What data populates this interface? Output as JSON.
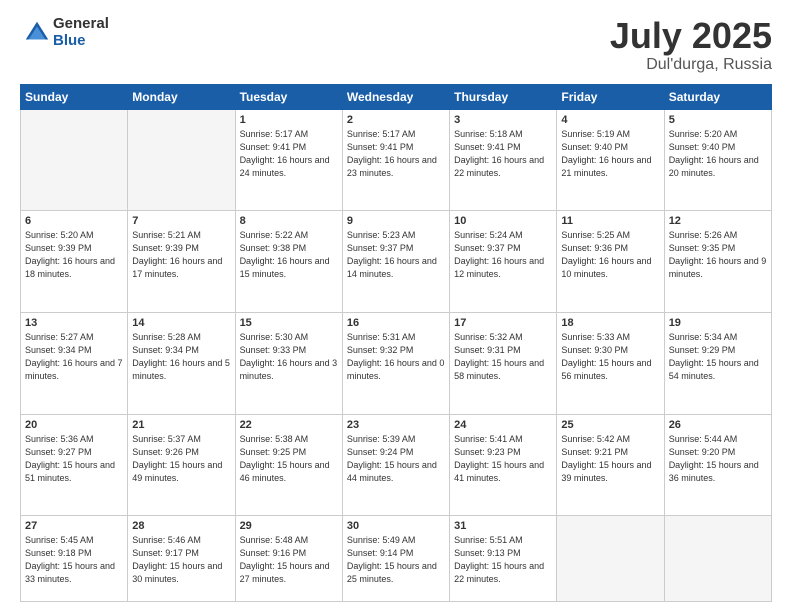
{
  "header": {
    "logo_general": "General",
    "logo_blue": "Blue",
    "title": "July 2025",
    "location": "Dul'durga, Russia"
  },
  "days_of_week": [
    "Sunday",
    "Monday",
    "Tuesday",
    "Wednesday",
    "Thursday",
    "Friday",
    "Saturday"
  ],
  "weeks": [
    [
      {
        "day": "",
        "info": ""
      },
      {
        "day": "",
        "info": ""
      },
      {
        "day": "1",
        "info": "Sunrise: 5:17 AM\nSunset: 9:41 PM\nDaylight: 16 hours\nand 24 minutes."
      },
      {
        "day": "2",
        "info": "Sunrise: 5:17 AM\nSunset: 9:41 PM\nDaylight: 16 hours\nand 23 minutes."
      },
      {
        "day": "3",
        "info": "Sunrise: 5:18 AM\nSunset: 9:41 PM\nDaylight: 16 hours\nand 22 minutes."
      },
      {
        "day": "4",
        "info": "Sunrise: 5:19 AM\nSunset: 9:40 PM\nDaylight: 16 hours\nand 21 minutes."
      },
      {
        "day": "5",
        "info": "Sunrise: 5:20 AM\nSunset: 9:40 PM\nDaylight: 16 hours\nand 20 minutes."
      }
    ],
    [
      {
        "day": "6",
        "info": "Sunrise: 5:20 AM\nSunset: 9:39 PM\nDaylight: 16 hours\nand 18 minutes."
      },
      {
        "day": "7",
        "info": "Sunrise: 5:21 AM\nSunset: 9:39 PM\nDaylight: 16 hours\nand 17 minutes."
      },
      {
        "day": "8",
        "info": "Sunrise: 5:22 AM\nSunset: 9:38 PM\nDaylight: 16 hours\nand 15 minutes."
      },
      {
        "day": "9",
        "info": "Sunrise: 5:23 AM\nSunset: 9:37 PM\nDaylight: 16 hours\nand 14 minutes."
      },
      {
        "day": "10",
        "info": "Sunrise: 5:24 AM\nSunset: 9:37 PM\nDaylight: 16 hours\nand 12 minutes."
      },
      {
        "day": "11",
        "info": "Sunrise: 5:25 AM\nSunset: 9:36 PM\nDaylight: 16 hours\nand 10 minutes."
      },
      {
        "day": "12",
        "info": "Sunrise: 5:26 AM\nSunset: 9:35 PM\nDaylight: 16 hours\nand 9 minutes."
      }
    ],
    [
      {
        "day": "13",
        "info": "Sunrise: 5:27 AM\nSunset: 9:34 PM\nDaylight: 16 hours\nand 7 minutes."
      },
      {
        "day": "14",
        "info": "Sunrise: 5:28 AM\nSunset: 9:34 PM\nDaylight: 16 hours\nand 5 minutes."
      },
      {
        "day": "15",
        "info": "Sunrise: 5:30 AM\nSunset: 9:33 PM\nDaylight: 16 hours\nand 3 minutes."
      },
      {
        "day": "16",
        "info": "Sunrise: 5:31 AM\nSunset: 9:32 PM\nDaylight: 16 hours\nand 0 minutes."
      },
      {
        "day": "17",
        "info": "Sunrise: 5:32 AM\nSunset: 9:31 PM\nDaylight: 15 hours\nand 58 minutes."
      },
      {
        "day": "18",
        "info": "Sunrise: 5:33 AM\nSunset: 9:30 PM\nDaylight: 15 hours\nand 56 minutes."
      },
      {
        "day": "19",
        "info": "Sunrise: 5:34 AM\nSunset: 9:29 PM\nDaylight: 15 hours\nand 54 minutes."
      }
    ],
    [
      {
        "day": "20",
        "info": "Sunrise: 5:36 AM\nSunset: 9:27 PM\nDaylight: 15 hours\nand 51 minutes."
      },
      {
        "day": "21",
        "info": "Sunrise: 5:37 AM\nSunset: 9:26 PM\nDaylight: 15 hours\nand 49 minutes."
      },
      {
        "day": "22",
        "info": "Sunrise: 5:38 AM\nSunset: 9:25 PM\nDaylight: 15 hours\nand 46 minutes."
      },
      {
        "day": "23",
        "info": "Sunrise: 5:39 AM\nSunset: 9:24 PM\nDaylight: 15 hours\nand 44 minutes."
      },
      {
        "day": "24",
        "info": "Sunrise: 5:41 AM\nSunset: 9:23 PM\nDaylight: 15 hours\nand 41 minutes."
      },
      {
        "day": "25",
        "info": "Sunrise: 5:42 AM\nSunset: 9:21 PM\nDaylight: 15 hours\nand 39 minutes."
      },
      {
        "day": "26",
        "info": "Sunrise: 5:44 AM\nSunset: 9:20 PM\nDaylight: 15 hours\nand 36 minutes."
      }
    ],
    [
      {
        "day": "27",
        "info": "Sunrise: 5:45 AM\nSunset: 9:18 PM\nDaylight: 15 hours\nand 33 minutes."
      },
      {
        "day": "28",
        "info": "Sunrise: 5:46 AM\nSunset: 9:17 PM\nDaylight: 15 hours\nand 30 minutes."
      },
      {
        "day": "29",
        "info": "Sunrise: 5:48 AM\nSunset: 9:16 PM\nDaylight: 15 hours\nand 27 minutes."
      },
      {
        "day": "30",
        "info": "Sunrise: 5:49 AM\nSunset: 9:14 PM\nDaylight: 15 hours\nand 25 minutes."
      },
      {
        "day": "31",
        "info": "Sunrise: 5:51 AM\nSunset: 9:13 PM\nDaylight: 15 hours\nand 22 minutes."
      },
      {
        "day": "",
        "info": ""
      },
      {
        "day": "",
        "info": ""
      }
    ]
  ]
}
